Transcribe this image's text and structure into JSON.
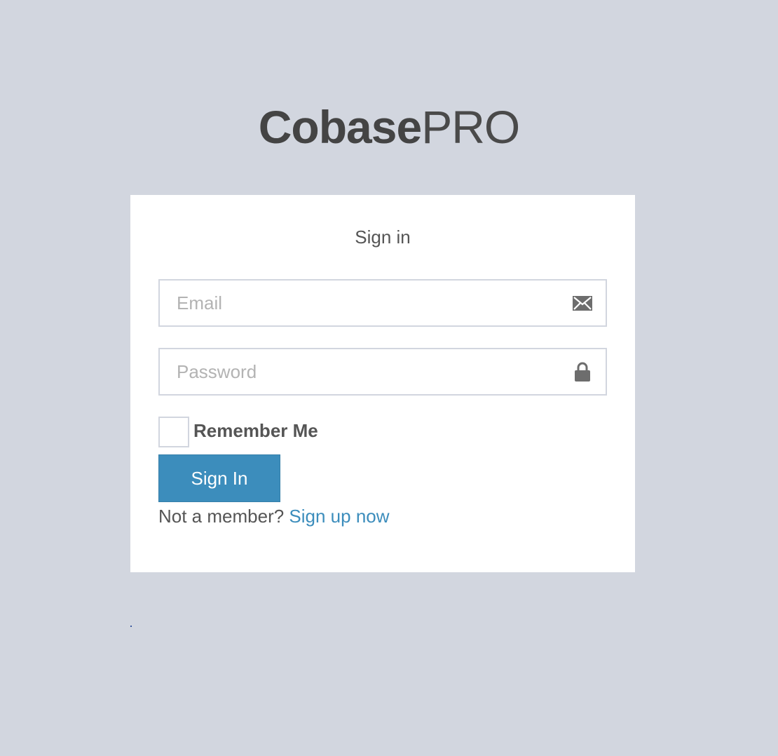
{
  "logo": {
    "bold": "Cobase",
    "light": "PRO"
  },
  "form": {
    "title": "Sign in",
    "email": {
      "placeholder": "Email",
      "value": "",
      "icon": "envelope-icon"
    },
    "password": {
      "placeholder": "Password",
      "value": "",
      "icon": "lock-icon"
    },
    "remember": {
      "label": "Remember Me",
      "checked": false
    },
    "submit_label": "Sign In",
    "register": {
      "prompt": "Not a member?",
      "link_label": "Sign up now"
    }
  },
  "colors": {
    "background": "#d2d6df",
    "card": "#ffffff",
    "primary": "#3c8dbc",
    "text": "#555555",
    "logo": "#444444"
  }
}
